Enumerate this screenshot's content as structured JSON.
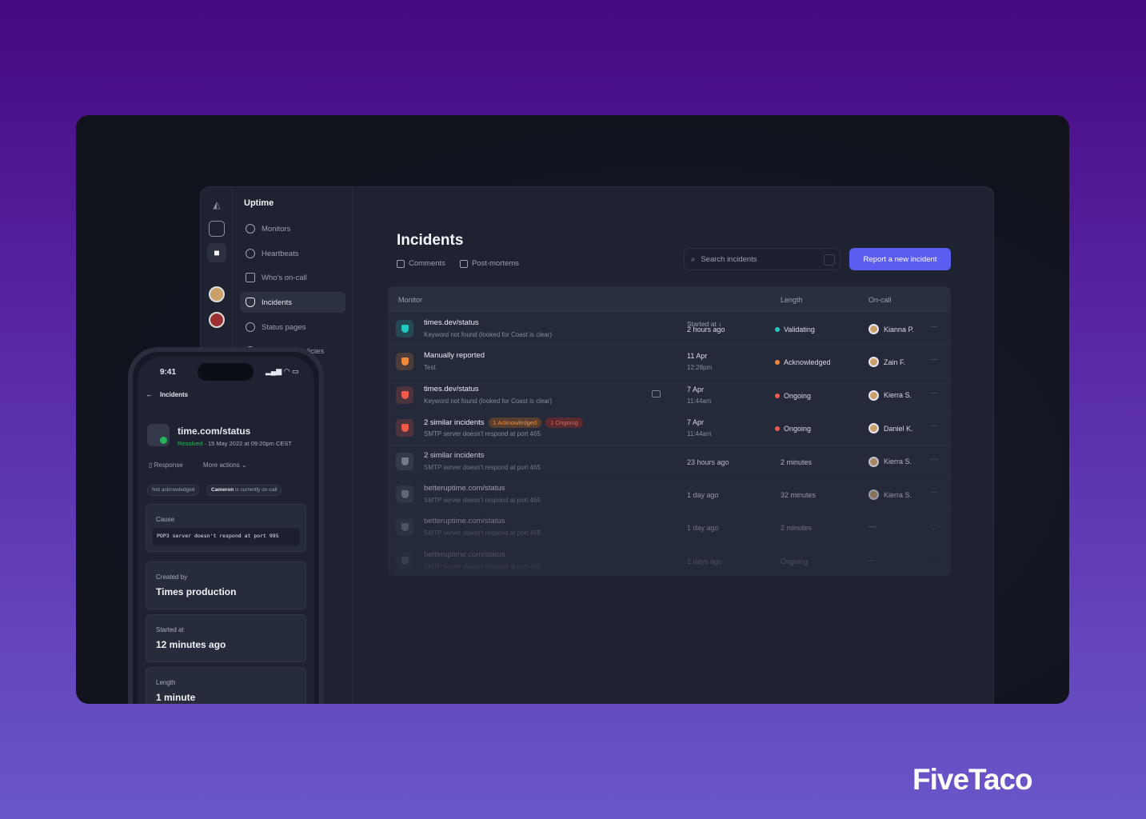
{
  "brand": "FiveTaco",
  "app": {
    "title": "Uptime",
    "nav": [
      {
        "label": "Monitors",
        "icon": "globe-icon"
      },
      {
        "label": "Heartbeats",
        "icon": "refresh-icon"
      },
      {
        "label": "Who's on-call",
        "icon": "calendar-icon"
      },
      {
        "label": "Incidents",
        "icon": "shield-icon",
        "active": true
      },
      {
        "label": "Status pages",
        "icon": "broadcast-icon"
      },
      {
        "label": "Escalation policies",
        "icon": "policy-icon"
      }
    ],
    "page_title": "Incidents",
    "tabs": [
      {
        "label": "Comments",
        "icon": "comment-icon"
      },
      {
        "label": "Post-mortems",
        "icon": "document-icon"
      }
    ],
    "search_placeholder": "Search incidents",
    "report_button": "Report a new incident",
    "columns": {
      "monitor": "Monitor",
      "started": "Started at ↓",
      "length": "Length",
      "oncall": "On-call"
    },
    "rows": [
      {
        "name": "times.dev/status",
        "desc": "Keyword not found (looked for Coast is clear)",
        "date": "2 hours ago",
        "time": "",
        "status": "Validating",
        "status_color": "#22c9c0",
        "icon_color": "#22c9c0",
        "person": "Kianna P."
      },
      {
        "name": "Manually reported",
        "desc": "Test",
        "date": "11 Apr",
        "time": "12:28pm",
        "status": "Acknowledged",
        "status_color": "#f08a3c",
        "icon_color": "#f08a3c",
        "person": "Zain F."
      },
      {
        "name": "times.dev/status",
        "desc": "Keyword not found (looked for Coast is clear)",
        "date": "7 Apr",
        "time": "11:44am",
        "status": "Ongoing",
        "status_color": "#ef5a4a",
        "icon_color": "#ef5a4a",
        "person": "Kierra S.",
        "comment": true
      },
      {
        "name": "2 similar incidents",
        "desc": "SMTP server doesn't respond at port 465",
        "date": "7 Apr",
        "time": "11:44am",
        "status": "Ongoing",
        "status_color": "#ef5a4a",
        "icon_color": "#ef5a4a",
        "person": "Daniel K.",
        "badges": [
          "1 Acknowledged",
          "1 Ongoing"
        ]
      },
      {
        "name": "2 similar incidents",
        "desc": "SMTP server doesn't respond at port 465",
        "date": "23 hours ago",
        "time": "",
        "status": "2 minutes",
        "status_color": "",
        "icon_color": "#8a90a3",
        "person": "Kierra S."
      },
      {
        "name": "betteruptime.com/status",
        "desc": "SMTP server doesn't respond at port 465",
        "date": "1 day ago",
        "time": "",
        "status": "32 minutes",
        "status_color": "",
        "icon_color": "#8a90a3",
        "person": "Kierra S."
      },
      {
        "name": "betteruptime.com/status",
        "desc": "SMTP server doesn't respond at port 465",
        "date": "1 day ago",
        "time": "",
        "status": "2 minutes",
        "status_color": "",
        "icon_color": "#8a90a3",
        "person": "—"
      },
      {
        "name": "betteruptime.com/status",
        "desc": "SMTP server doesn't respond at port 465",
        "date": "2 days ago",
        "time": "",
        "status": "Ongoing",
        "status_color": "",
        "icon_color": "#8a90a3",
        "person": "—"
      }
    ]
  },
  "phone": {
    "time": "9:41",
    "back": "Incidents",
    "monitor": "time.com/status",
    "status": "Resolved",
    "date": " · 15 May 2022 at 09:20pm CEST",
    "response": "Response",
    "more_actions": "More actions",
    "chip1": "Not acknowledged",
    "chip2_name": "Cameron",
    "chip2_rest": " is currently on-call",
    "cards": [
      {
        "label": "Cause",
        "value": "POP3 server doesn't respond at port 995"
      },
      {
        "label": "Created by",
        "value": "Times production"
      },
      {
        "label": "Started at",
        "value": "12 minutes ago"
      },
      {
        "label": "Length",
        "value": "1 minute"
      }
    ]
  }
}
